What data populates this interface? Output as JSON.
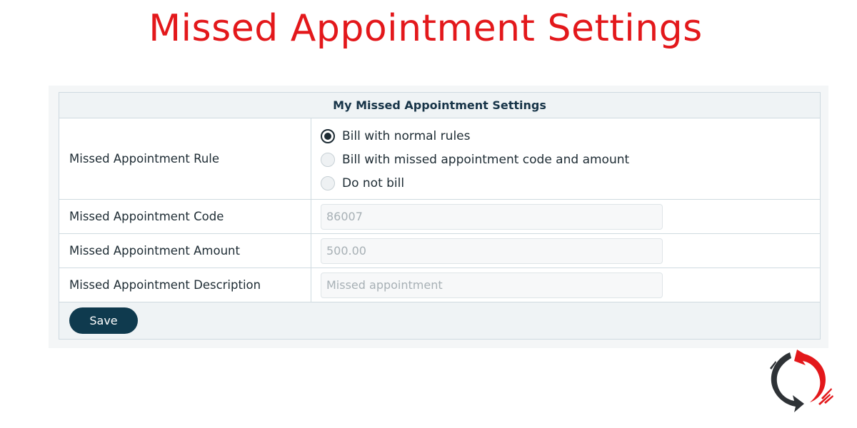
{
  "page": {
    "title": "Missed Appointment Settings"
  },
  "panel": {
    "header": "My Missed Appointment Settings",
    "rule": {
      "label": "Missed Appointment Rule",
      "options": [
        {
          "label": "Bill with normal rules",
          "selected": true
        },
        {
          "label": "Bill with missed appointment code and amount",
          "selected": false
        },
        {
          "label": "Do not bill",
          "selected": false
        }
      ]
    },
    "code": {
      "label": "Missed Appointment Code",
      "value": "86007"
    },
    "amount": {
      "label": "Missed Appointment Amount",
      "value": "500.00"
    },
    "description": {
      "label": "Missed Appointment Description",
      "value": "Missed appointment"
    },
    "save_label": "Save"
  },
  "colors": {
    "title_red": "#e3181b",
    "save_button": "#0f3a4e",
    "border": "#cfdae0",
    "header_bg": "#eff3f5"
  },
  "icons": {
    "logo": "refresh-arrows-logo-icon"
  }
}
